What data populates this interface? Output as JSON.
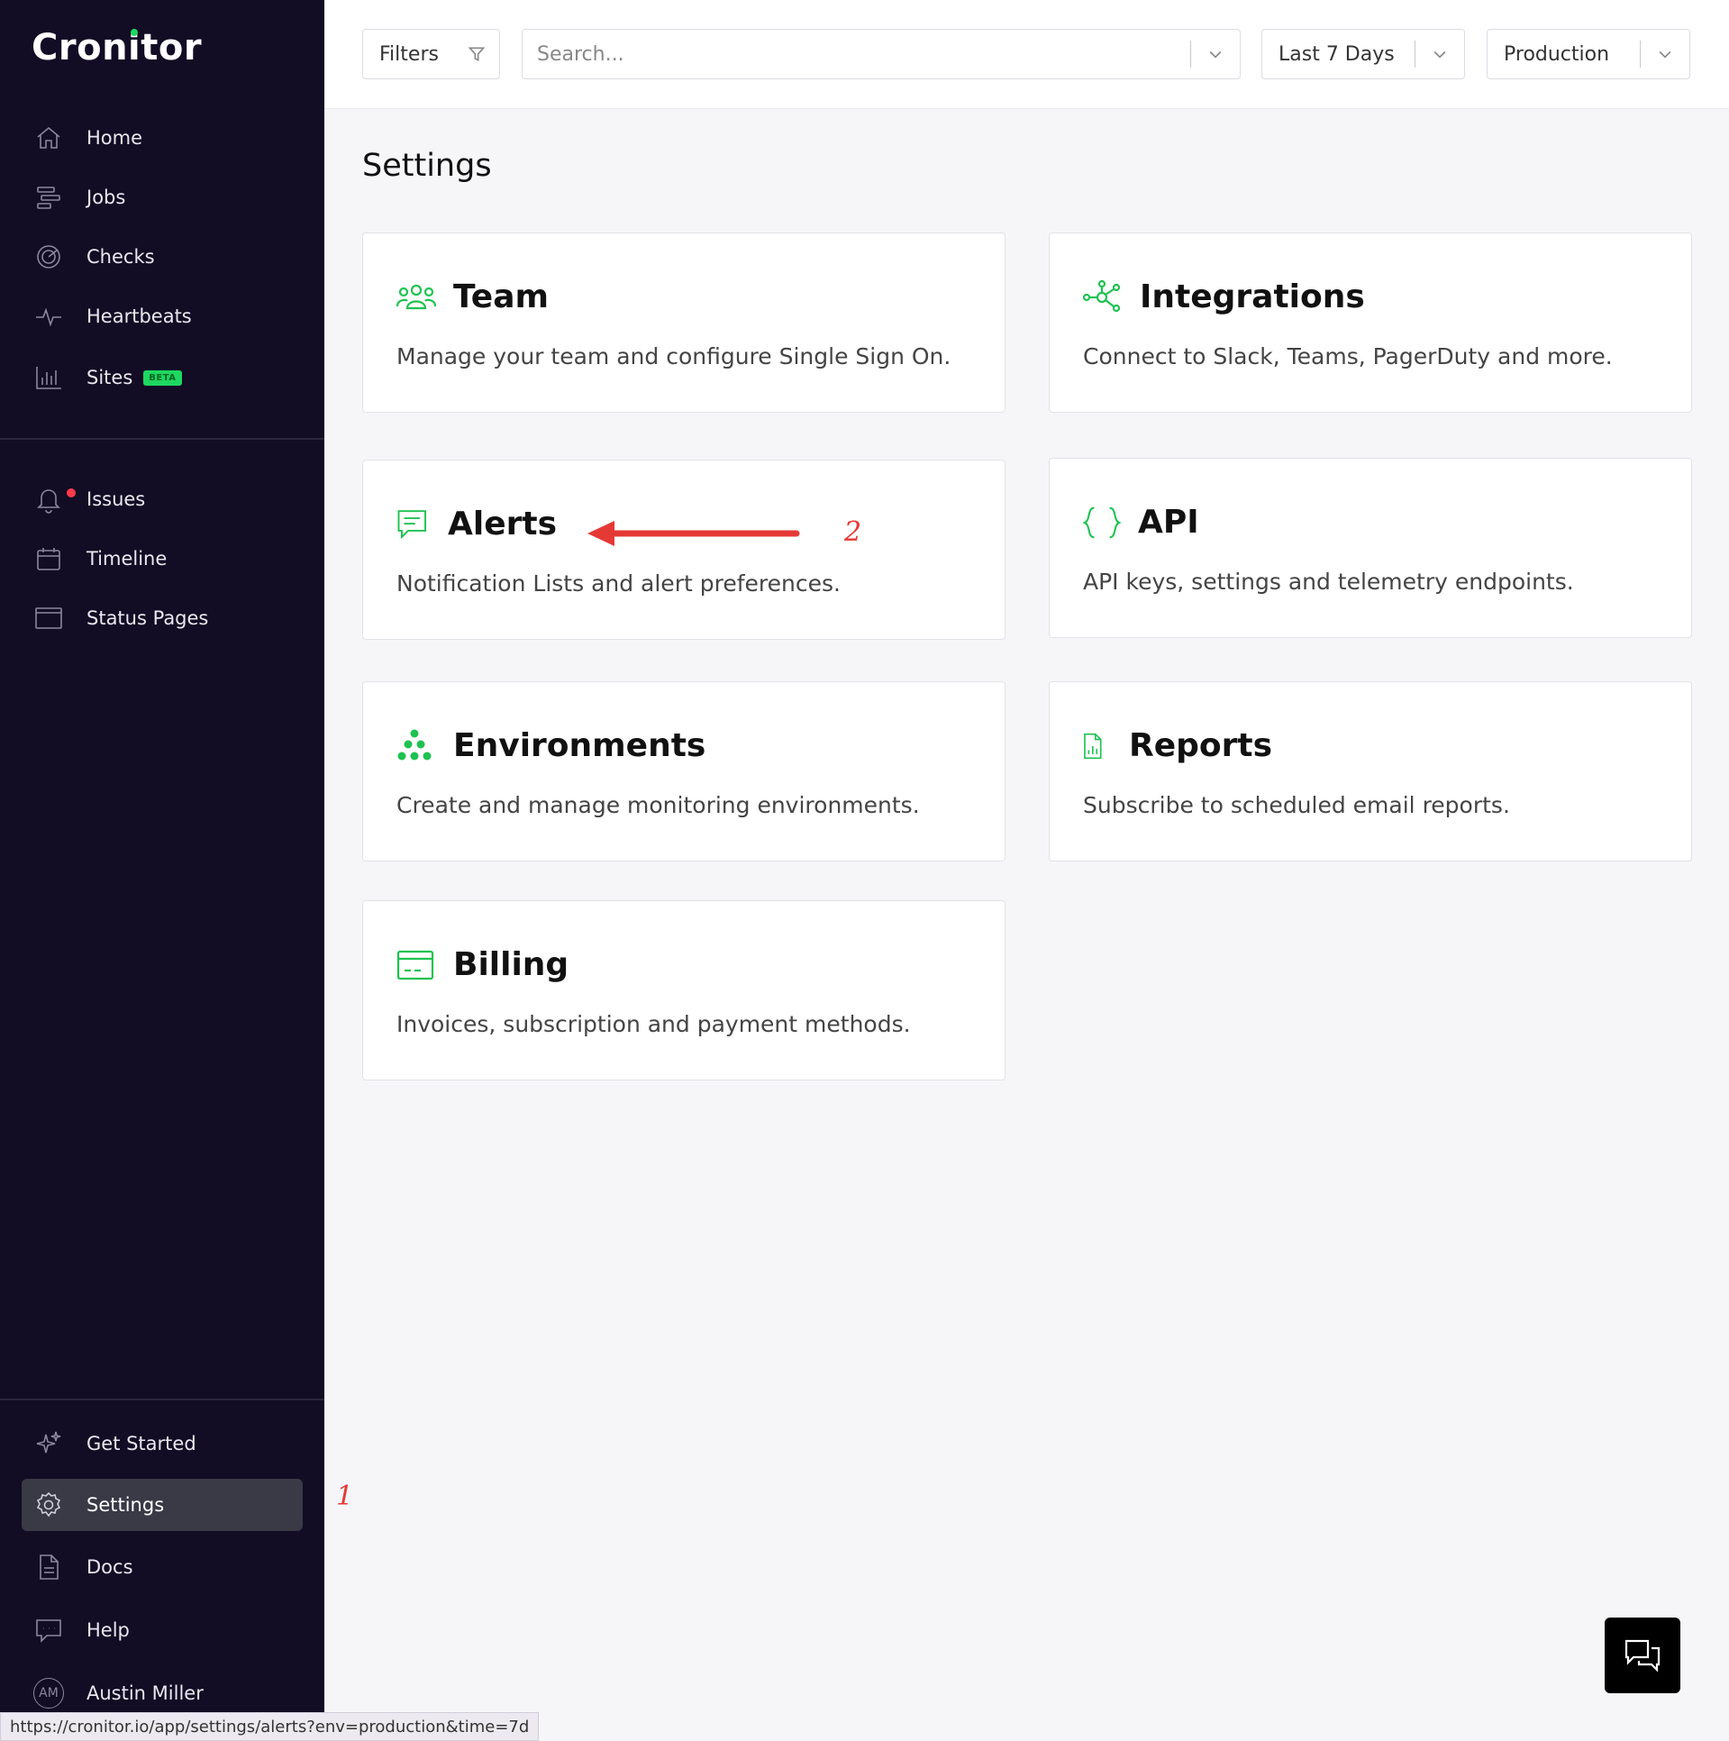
{
  "app": {
    "logo_text": "Cronitor"
  },
  "sidebar": {
    "primary": [
      {
        "label": "Home",
        "icon": "home-icon"
      },
      {
        "label": "Jobs",
        "icon": "jobs-icon"
      },
      {
        "label": "Checks",
        "icon": "checks-icon"
      },
      {
        "label": "Heartbeats",
        "icon": "heartbeat-icon"
      },
      {
        "label": "Sites",
        "icon": "chart-bars-icon",
        "badge": "BETA"
      }
    ],
    "secondary": [
      {
        "label": "Issues",
        "icon": "bell-icon"
      },
      {
        "label": "Timeline",
        "icon": "calendar-icon"
      },
      {
        "label": "Status Pages",
        "icon": "window-icon"
      }
    ],
    "bottom": [
      {
        "label": "Get Started",
        "icon": "sparkle-icon"
      },
      {
        "label": "Settings",
        "icon": "gear-icon",
        "active": true
      },
      {
        "label": "Docs",
        "icon": "document-icon"
      },
      {
        "label": "Help",
        "icon": "chat-bubble-icon"
      }
    ],
    "user": {
      "initials": "AM",
      "name": "Austin Miller"
    }
  },
  "topbar": {
    "filters_label": "Filters",
    "search_placeholder": "Search...",
    "time_range": "Last 7 Days",
    "environment": "Production"
  },
  "main": {
    "title": "Settings",
    "cards": [
      {
        "title": "Team",
        "desc": "Manage your team and configure Single Sign On.",
        "icon": "team-icon"
      },
      {
        "title": "Integrations",
        "desc": "Connect to Slack, Teams, PagerDuty and more.",
        "icon": "integrations-icon"
      },
      {
        "title": "Alerts",
        "desc": "Notification Lists and alert preferences.",
        "icon": "alert-message-icon"
      },
      {
        "title": "API",
        "desc": "API keys, settings and telemetry endpoints.",
        "icon": "braces-icon"
      },
      {
        "title": "Environments",
        "desc": "Create and manage monitoring environments.",
        "icon": "environments-icon"
      },
      {
        "title": "Reports",
        "desc": "Subscribe to scheduled email reports.",
        "icon": "report-icon"
      },
      {
        "title": "Billing",
        "desc": "Invoices, subscription and payment methods.",
        "icon": "credit-card-icon"
      }
    ]
  },
  "annotations": {
    "step1": "1",
    "step2": "2",
    "arrow_color": "#e53935"
  },
  "status_url": "https://cronitor.io/app/settings/alerts?env=production&time=7d",
  "colors": {
    "sidebar_bg": "#120c24",
    "accent": "#1ec250",
    "active_item": "#3a3946"
  }
}
